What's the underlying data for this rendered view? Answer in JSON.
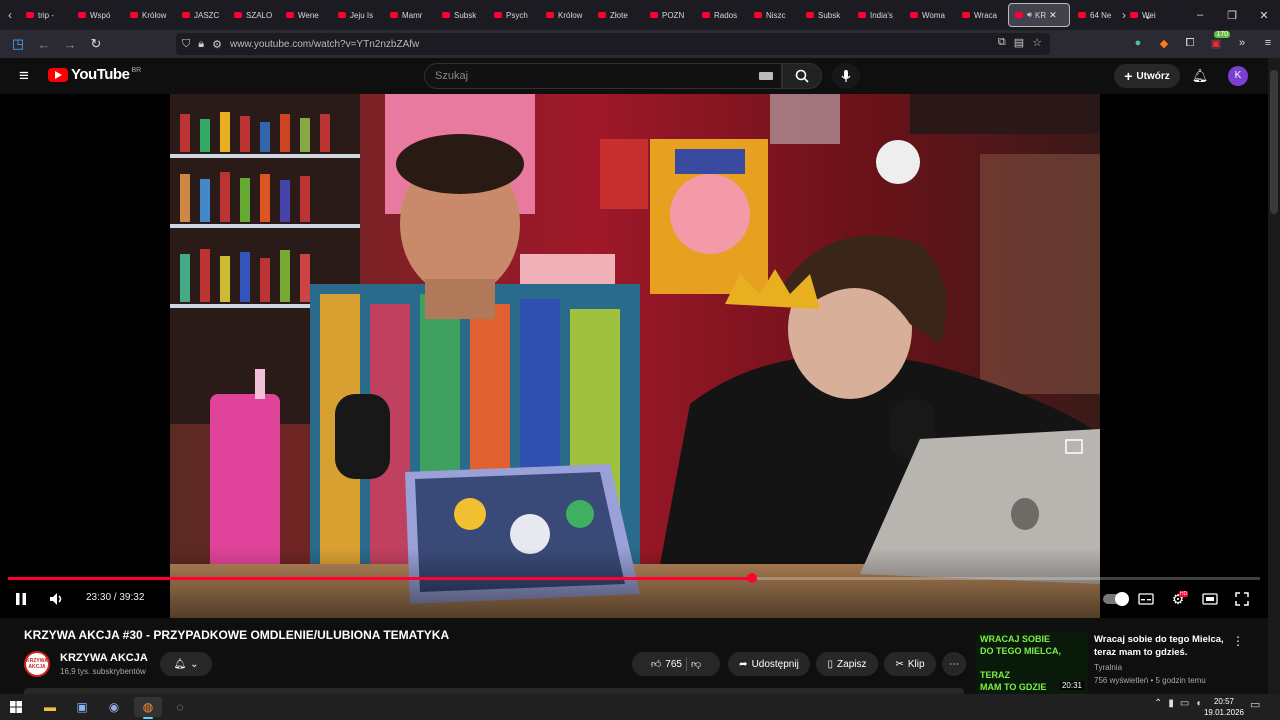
{
  "browser": {
    "tabs": [
      {
        "label": "trip -"
      },
      {
        "label": "Wspó"
      },
      {
        "label": "Królow"
      },
      {
        "label": "JASZC"
      },
      {
        "label": "SZALO"
      },
      {
        "label": "Wene"
      },
      {
        "label": "Jeju Is"
      },
      {
        "label": "Mamr"
      },
      {
        "label": "Subsk"
      },
      {
        "label": "Psych"
      },
      {
        "label": "Królow"
      },
      {
        "label": "Złote"
      },
      {
        "label": "POZN"
      },
      {
        "label": "Rados"
      },
      {
        "label": "Niszc"
      },
      {
        "label": "Subsk"
      },
      {
        "label": "India's"
      },
      {
        "label": "Woma"
      },
      {
        "label": "Wraca"
      },
      {
        "label": "KR"
      },
      {
        "label": "64 Ne"
      },
      {
        "label": "Wei"
      }
    ],
    "active_tab_index": 19,
    "url": "www.youtube.com/watch?v=YTn2nzbZAfw",
    "extension_badge": "170"
  },
  "youtube": {
    "logo_text": "YouTube",
    "region": "BR",
    "search_placeholder": "Szukaj",
    "create_label": "Utwórz",
    "avatar_letter": "K"
  },
  "player": {
    "current_time": "23:30",
    "duration": "39:32",
    "time_display": "23:30 / 39:32",
    "progress_fraction": 0.594,
    "settings_badge": "HD"
  },
  "video": {
    "title": "KRZYWA AKCJA #30 - PRZYPADKOWE OMDLENIE/ULUBIONA TEMATYKA",
    "channel_name": "KRZYWA AKCJA",
    "subscribers": "16,9 tys. subskrybentów",
    "channel_avatar_text": "KRZYWA AKCJA",
    "likes": "765",
    "share_label": "Udostępnij",
    "save_label": "Zapisz",
    "clip_label": "Klip"
  },
  "recommendation": {
    "thumb_lines": [
      "WRACAJ SOBIE",
      "DO TEGO MIELCA,",
      "TERAZ",
      "MAM TO GDZIE"
    ],
    "duration": "20:31",
    "title": "Wracaj sobie do tego Mielca, teraz mam to gdzieś.",
    "channel": "Tyralnia",
    "meta": "756 wyświetleń • 5 godzin temu"
  },
  "taskbar": {
    "time": "20:57",
    "date": "19.01.2026"
  },
  "colors": {
    "accent_red": "#ff0033",
    "background": "#0f0f0f",
    "avatar_purple": "#7b3fd1"
  }
}
